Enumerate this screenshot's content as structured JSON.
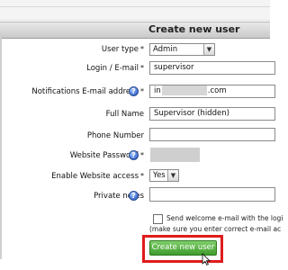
{
  "header": {
    "title": "Create new user"
  },
  "form": {
    "user_type": {
      "label": "User type",
      "required": "*",
      "value": "Admin"
    },
    "login": {
      "label": "Login / E-mail",
      "required": "*",
      "value": "supervisor"
    },
    "notifications_email": {
      "label": "Notifications E-mail address",
      "required": "*",
      "value_prefix": "in",
      "value_suffix": ".com"
    },
    "full_name": {
      "label": "Full Name",
      "value": "Supervisor (hidden)"
    },
    "phone": {
      "label": "Phone Number",
      "value": ""
    },
    "website_password": {
      "label": "Website Password",
      "required": "*"
    },
    "enable_website_access": {
      "label": "Enable Website access",
      "required": "*",
      "value": "Yes"
    },
    "private_notes": {
      "label": "Private notes",
      "value": ""
    },
    "welcome_email": {
      "line1": "Send welcome e-mail with the logi",
      "line2": "(make sure you enter correct e-mail ac"
    }
  },
  "actions": {
    "create_label": "Create new user"
  },
  "colors": {
    "accent_green": "#4aa635",
    "highlight_red": "#e01b1b",
    "help_blue": "#3f6fcf"
  },
  "icons": {
    "help": "help-icon",
    "cursor": "mouse-pointer-icon"
  }
}
